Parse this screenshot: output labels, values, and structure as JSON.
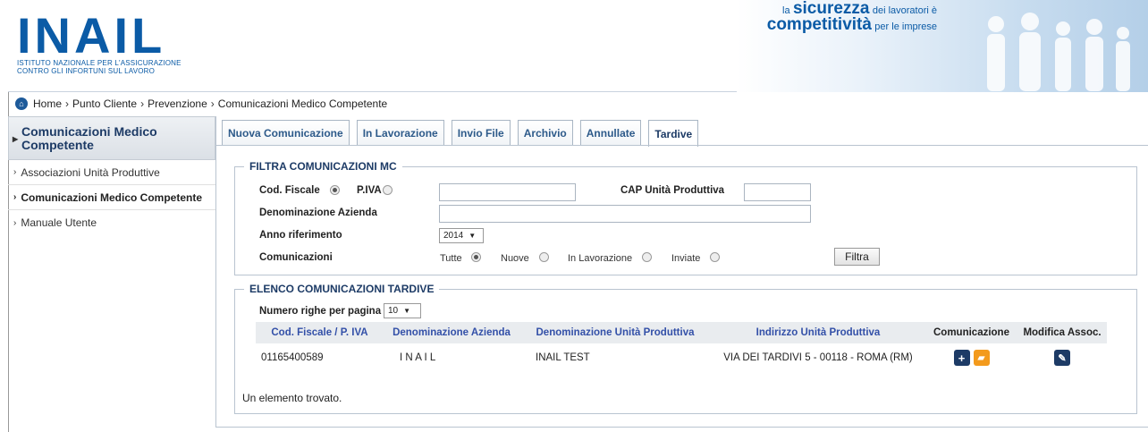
{
  "header": {
    "logo_text": "INAIL",
    "logo_sub_line1": "ISTITUTO NAZIONALE PER L'ASSICURAZIONE",
    "logo_sub_line2": "CONTRO GLI INFORTUNI SUL LAVORO",
    "tagline_pre": "la",
    "tagline_big1": "sicurezza",
    "tagline_mid": "dei lavoratori è",
    "tagline_big2": "competitività",
    "tagline_post": "per le imprese"
  },
  "breadcrumb": {
    "home": "Home",
    "items": [
      "Punto Cliente",
      "Prevenzione",
      "Comunicazioni Medico Competente"
    ]
  },
  "sidebar": {
    "header": "Comunicazioni Medico Competente",
    "items": [
      {
        "label": "Associazioni Unità Produttive"
      },
      {
        "label": "Comunicazioni Medico Competente"
      },
      {
        "label": "Manuale Utente"
      }
    ]
  },
  "tabs": [
    "Nuova Comunicazione",
    "In Lavorazione",
    "Invio File",
    "Archivio",
    "Annullate",
    "Tardive"
  ],
  "filter": {
    "legend": "FILTRA COMUNICAZIONI MC",
    "cod_fiscale_label": "Cod. Fiscale",
    "piva_label": "P.IVA",
    "cap_label": "CAP Unità Produttiva",
    "denominazione_label": "Denominazione Azienda",
    "anno_label": "Anno riferimento",
    "anno_value": "2014",
    "comunicazioni_label": "Comunicazioni",
    "options": [
      "Tutte",
      "Nuove",
      "In Lavorazione",
      "Inviate"
    ],
    "button": "Filtra"
  },
  "list": {
    "legend": "ELENCO COMUNICAZIONI TARDIVE",
    "rows_label": "Numero righe per pagina",
    "rows_value": "10",
    "columns": [
      "Cod. Fiscale / P. IVA",
      "Denominazione Azienda",
      "Denominazione Unità Produttiva",
      "Indirizzo Unità Produttiva",
      "Comunicazione",
      "Modifica Assoc."
    ],
    "rows": [
      {
        "cf": "01165400589",
        "azienda": "I N A I L",
        "unita": "INAIL TEST",
        "indirizzo": "VIA DEI TARDIVI 5 - 00118 - ROMA (RM)"
      }
    ],
    "footer": "Un elemento trovato."
  }
}
